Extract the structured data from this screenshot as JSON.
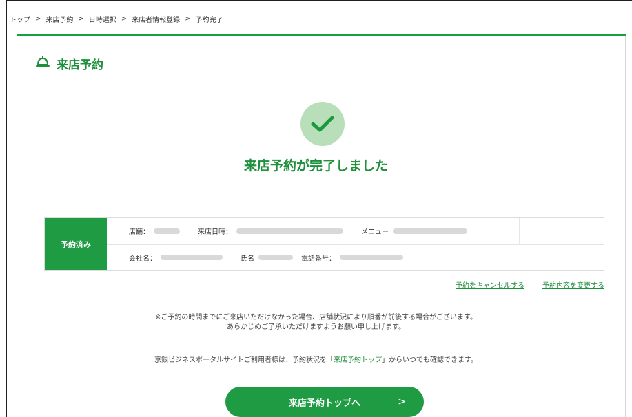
{
  "breadcrumb": {
    "items": [
      "トップ",
      "来店予約",
      "日時選択",
      "来店者情報登録",
      "予約完了"
    ],
    "separator": ">"
  },
  "header": {
    "title": "来店予約",
    "icon": "reception-bell-icon"
  },
  "complete": {
    "message": "来店予約が完了しました",
    "icon": "check-icon"
  },
  "reservation": {
    "status": "予約済み",
    "store_label": "店舗：",
    "datetime_label": "来店日時：",
    "menu_label": "メニュー",
    "company_label": "会社名：",
    "name_label": "氏名",
    "phone_label": "電話番号："
  },
  "links": {
    "cancel": "予約をキャンセルする",
    "change": "予約内容を変更する"
  },
  "notice": {
    "line1": "※ご予約の時間までにご来店いただけなかった場合、店舗状況により順番が前後する場合がございます。",
    "line2": "あらかじめご了承いただけますようお願い申し上げます。"
  },
  "portal": {
    "before": "京銀ビジネスポータルサイトご利用者様は、予約状況を「",
    "link": "来店予約トップ",
    "after": "」からいつでも確認できます。"
  },
  "button": {
    "label": "来店予約トップへ",
    "arrow": ">"
  },
  "colors": {
    "accent": "#1f9c43",
    "accent_light": "#b8dfb9",
    "text_green": "#1e8f3a"
  }
}
